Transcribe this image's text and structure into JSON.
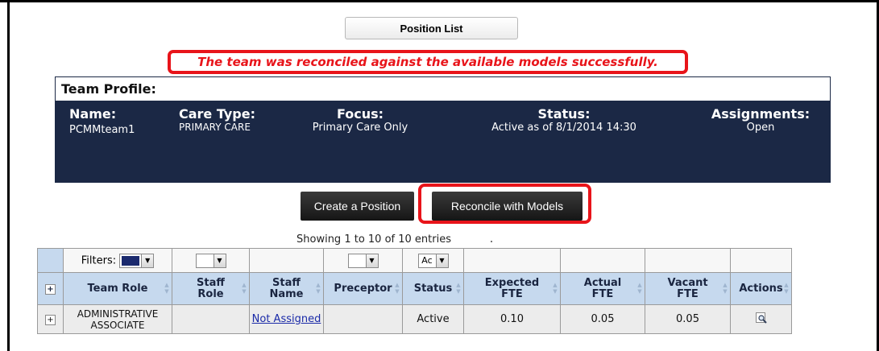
{
  "header": {
    "position_list_button": "Position List"
  },
  "success_message": "The team was reconciled against the available models successfully.",
  "profile": {
    "title": "Team Profile:",
    "fields": [
      {
        "label": "Name:",
        "value": "PCMMteam1"
      },
      {
        "label": "Care Type:",
        "value": "PRIMARY CARE"
      },
      {
        "label": "Focus:",
        "value": "Primary Care Only"
      },
      {
        "label": "Status:",
        "value": "Active as of 8/1/2014 14:30"
      },
      {
        "label": "Assignments:",
        "value": "Open"
      }
    ]
  },
  "actions": {
    "create_position": "Create a Position",
    "reconcile": "Reconcile with Models"
  },
  "table": {
    "showing_text": "Showing 1 to 10 of 10 entries",
    "filters_label": "Filters:",
    "status_filter_value": "Ac",
    "columns": [
      "Team Role",
      "Staff Role",
      "Staff Name",
      "Preceptor",
      "Status",
      "Expected FTE",
      "Actual FTE",
      "Vacant FTE",
      "Actions"
    ],
    "rows": [
      {
        "team_role": "ADMINISTRATIVE ASSOCIATE",
        "staff_role": "",
        "staff_name": "Not Assigned",
        "preceptor": "",
        "status": "Active",
        "expected_fte": "0.10",
        "actual_fte": "0.05",
        "vacant_fte": "0.05"
      }
    ]
  }
}
